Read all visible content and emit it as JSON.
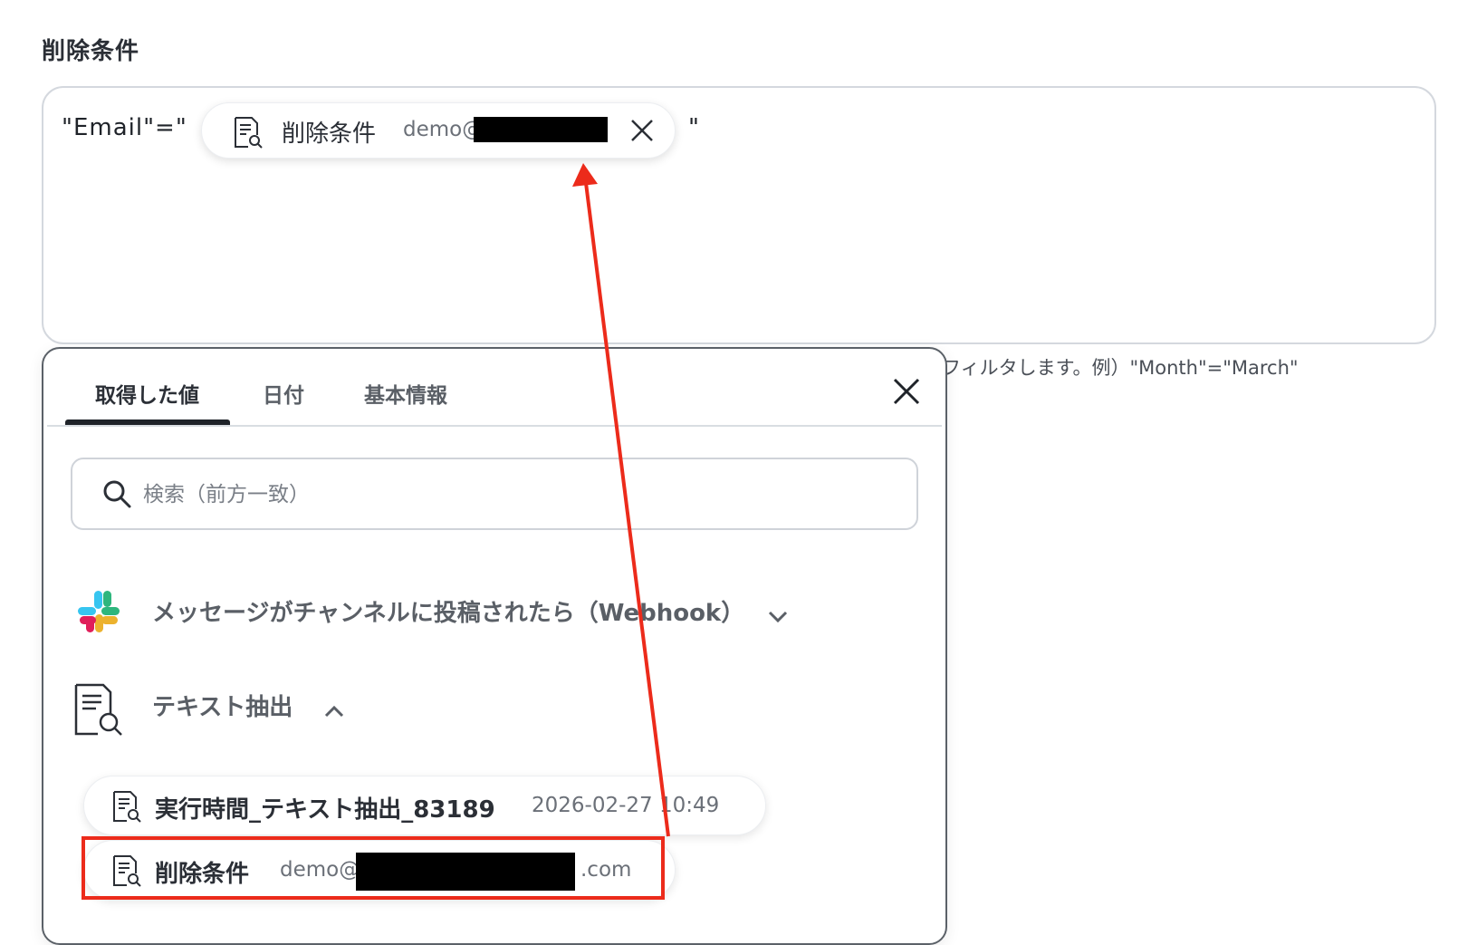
{
  "section": {
    "label": "削除条件"
  },
  "expression": {
    "prefix": "\"Email\"=\"",
    "suffix": "\"",
    "token": {
      "label": "削除条件",
      "value": "demo@"
    }
  },
  "helper_text": "フィルタします。例）\"Month\"=\"March\"",
  "panel": {
    "tabs": [
      {
        "label": "取得した値",
        "active": true
      },
      {
        "label": "日付",
        "active": false
      },
      {
        "label": "基本情報",
        "active": false
      }
    ],
    "search": {
      "placeholder": "検索（前方一致）",
      "value": ""
    },
    "groups": [
      {
        "title": "メッセージがチャンネルに投稿されたら（Webhook）",
        "icon": "slack-icon",
        "expanded": false
      },
      {
        "title": "テキスト抽出",
        "icon": "document-search-icon",
        "expanded": true
      }
    ],
    "items": [
      {
        "label": "実行時間_テキスト抽出_83189",
        "value": "2026-02-27 10:49"
      },
      {
        "label": "削除条件",
        "value_prefix": "demo@",
        "value_suffix": ".com"
      }
    ]
  },
  "colors": {
    "annotation": "#ec2b1b",
    "tab_active": "#1f2329",
    "border": "#d4d8de"
  }
}
